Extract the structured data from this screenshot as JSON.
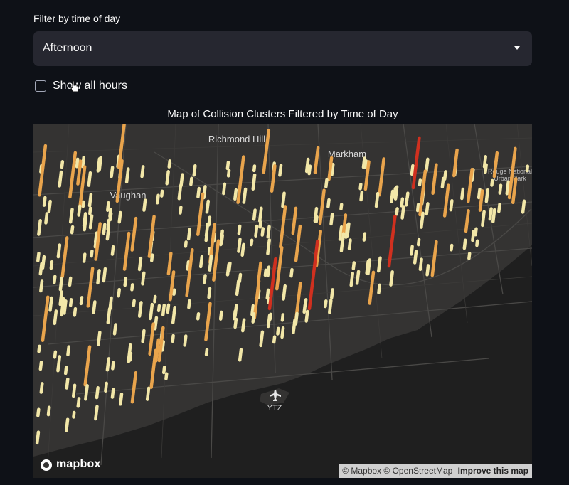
{
  "filter": {
    "label": "Filter by time of day",
    "selected": "Afternoon"
  },
  "show_all": {
    "label": "Show all hours",
    "checked": false
  },
  "map": {
    "title": "Map of Collision Clusters Filtered by Time of Day",
    "place_labels": [
      "Richmond Hill",
      "Markham",
      "Vaughan",
      "Rouge National",
      "Urban Park",
      "YTZ"
    ],
    "attribution": {
      "mapbox": "© Mapbox",
      "osm": "© OpenStreetMap",
      "improve": "Improve this map"
    },
    "logo_text": "mapbox",
    "colors": {
      "land": "#343332",
      "water": "#1f1f1f",
      "road": "#4a4947",
      "low": "#f2e7a8",
      "mid": "#e9a44c",
      "high": "#d0301f"
    }
  }
}
